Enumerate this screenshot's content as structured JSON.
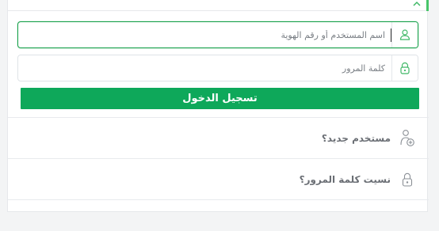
{
  "login": {
    "username_placeholder": "اسم المستخدم أو رقم الهوية",
    "username_value": "",
    "password_placeholder": "كلمة المرور",
    "password_value": "",
    "submit_label": "تسجيل الدخول"
  },
  "links": {
    "new_user": "مستخدم جديد؟",
    "forgot_password": "نسيت كلمة المرور؟"
  },
  "icons": {
    "username": "user-icon",
    "password": "lock-icon",
    "new_user": "add-user-icon",
    "forgot_password": "unlock-icon",
    "top": "chevron-up-icon"
  },
  "colors": {
    "accent": "#0ea85a",
    "focus_border": "#17a04a",
    "icon_green": "#3fb866",
    "link_text": "#6b6f75",
    "link_icon": "#8a8f95"
  }
}
